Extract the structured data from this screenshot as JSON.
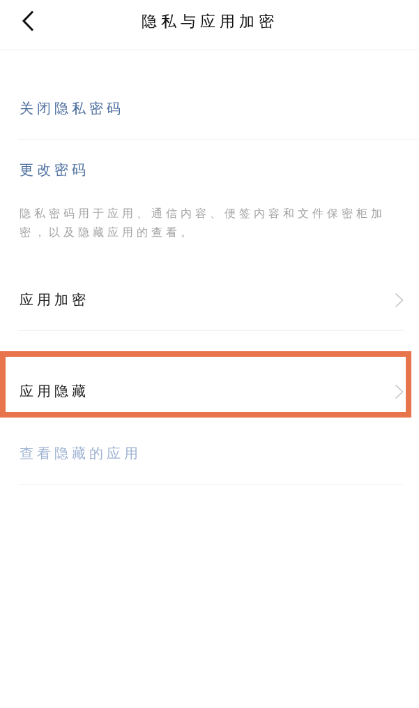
{
  "header": {
    "title": "隐私与应用加密"
  },
  "sections": [
    {
      "items": [
        {
          "kind": "link",
          "label": "关闭隐私密码",
          "disabled": false,
          "highlighted": false
        },
        {
          "kind": "link",
          "label": "更改密码",
          "disabled": false,
          "highlighted": false
        }
      ],
      "note": "隐私密码用于应用、通信内容、便签内容和文件保密柜加密，以及隐藏应用的查看。"
    },
    {
      "items": [
        {
          "kind": "nav",
          "label": "应用加密",
          "disabled": false,
          "highlighted": false
        }
      ]
    },
    {
      "items": [
        {
          "kind": "nav",
          "label": "应用隐藏",
          "disabled": false,
          "highlighted": true
        },
        {
          "kind": "link",
          "label": "查看隐藏的应用",
          "disabled": true,
          "highlighted": false
        }
      ]
    }
  ]
}
